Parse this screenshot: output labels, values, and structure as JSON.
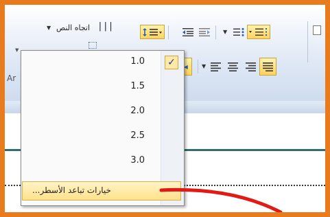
{
  "ribbon": {
    "text_direction_label": "اتجاه النص",
    "text_direction_arrow": "▼",
    "left_clipped_text": "Ar"
  },
  "line_spacing_menu": {
    "items": [
      {
        "label": "1.0",
        "checked": true
      },
      {
        "label": "1.5",
        "checked": false
      },
      {
        "label": "2.0",
        "checked": false
      },
      {
        "label": "2.5",
        "checked": false
      },
      {
        "label": "3.0",
        "checked": false
      }
    ],
    "check_mark": "✓",
    "options_label": "خيارات تباعد الأسطر..."
  },
  "colors": {
    "frame_border": "#e87b1e",
    "highlight": "#ffe28a",
    "annotation_curve": "#e11a14",
    "slide_line": "#2f6e6a"
  },
  "icons": [
    "line-spacing-icon",
    "decrease-indent-icon",
    "increase-indent-icon",
    "bullets-icon",
    "numbering-icon",
    "rtl-paragraph-icon",
    "align-left-icon",
    "align-center-icon",
    "align-right-icon",
    "justify-icon",
    "text-direction-icon",
    "checkmark-icon"
  ]
}
